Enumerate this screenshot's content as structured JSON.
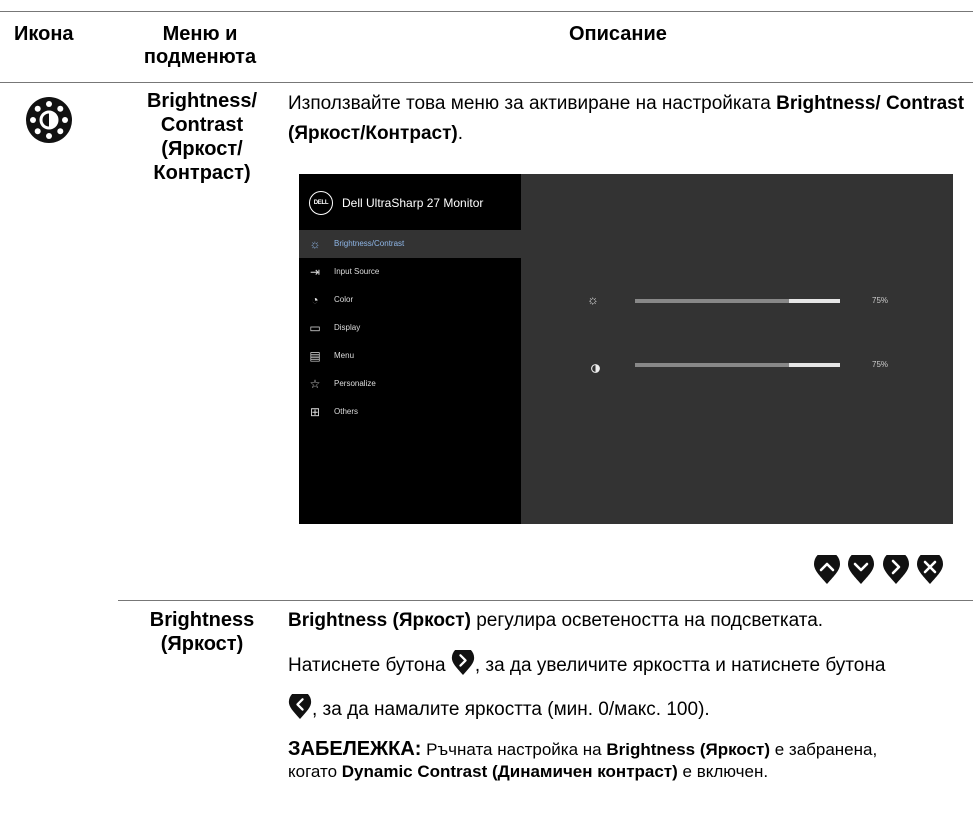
{
  "table_header": {
    "col_icon": "Икона",
    "col_menu": "Меню и подменюта",
    "col_desc": "Описание"
  },
  "row1": {
    "name": "Brightness/ Contrast (Яркост/ Контраст)",
    "desc_text_1": "Използвайте това меню за активиране на настройката ",
    "desc_bold_1": "Brightness/ Contrast (Яркост/Контраст)",
    "desc_text_2": "."
  },
  "osd": {
    "logo_text": "DELL",
    "title": "Dell UltraSharp 27 Monitor",
    "menu_items": [
      {
        "label": "Brightness/Contrast",
        "icon": "sun-icon",
        "active": true
      },
      {
        "label": "Input Source",
        "icon": "input-source-icon",
        "active": false
      },
      {
        "label": "Color",
        "icon": "color-palette-icon",
        "active": false
      },
      {
        "label": "Display",
        "icon": "display-monitor-icon",
        "active": false
      },
      {
        "label": "Menu",
        "icon": "menu-list-icon",
        "active": false
      },
      {
        "label": "Personalize",
        "icon": "star-icon",
        "active": false
      },
      {
        "label": "Others",
        "icon": "others-icon",
        "active": false
      }
    ],
    "brightness": {
      "icon": "sun-icon",
      "value_label": "75%",
      "value": 0.75
    },
    "contrast": {
      "icon": "contrast-icon",
      "value_label": "75%",
      "value": 0.75
    },
    "colors": {
      "panel_left": "#000000",
      "panel_right": "#333333",
      "active_label": "#8fb7e8"
    }
  },
  "nav_buttons": [
    "up-button-icon",
    "down-button-icon",
    "right-button-icon",
    "close-button-icon"
  ],
  "row2": {
    "name": "Brightness (Яркост)",
    "p1_bold": "Brightness (Яркост)",
    "p1_text": " регулира осветеността на подсветката.",
    "p2_text_a": "Натиснете бутона ",
    "p2_text_b": ", за да увеличите яркостта и натиснете бутона",
    "p3_text": ", за да намалите яркостта (мин. 0/макс. 100).",
    "note_label": "ЗАБЕЛЕЖКА:",
    "note_text_1": " Ръчната настройка на ",
    "note_bold_1": "Brightness (Яркост)",
    "note_text_2": " е забранена, когато ",
    "note_bold_2": "Dynamic Contrast (Динамичен контраст)",
    "note_text_3": " е включен."
  }
}
